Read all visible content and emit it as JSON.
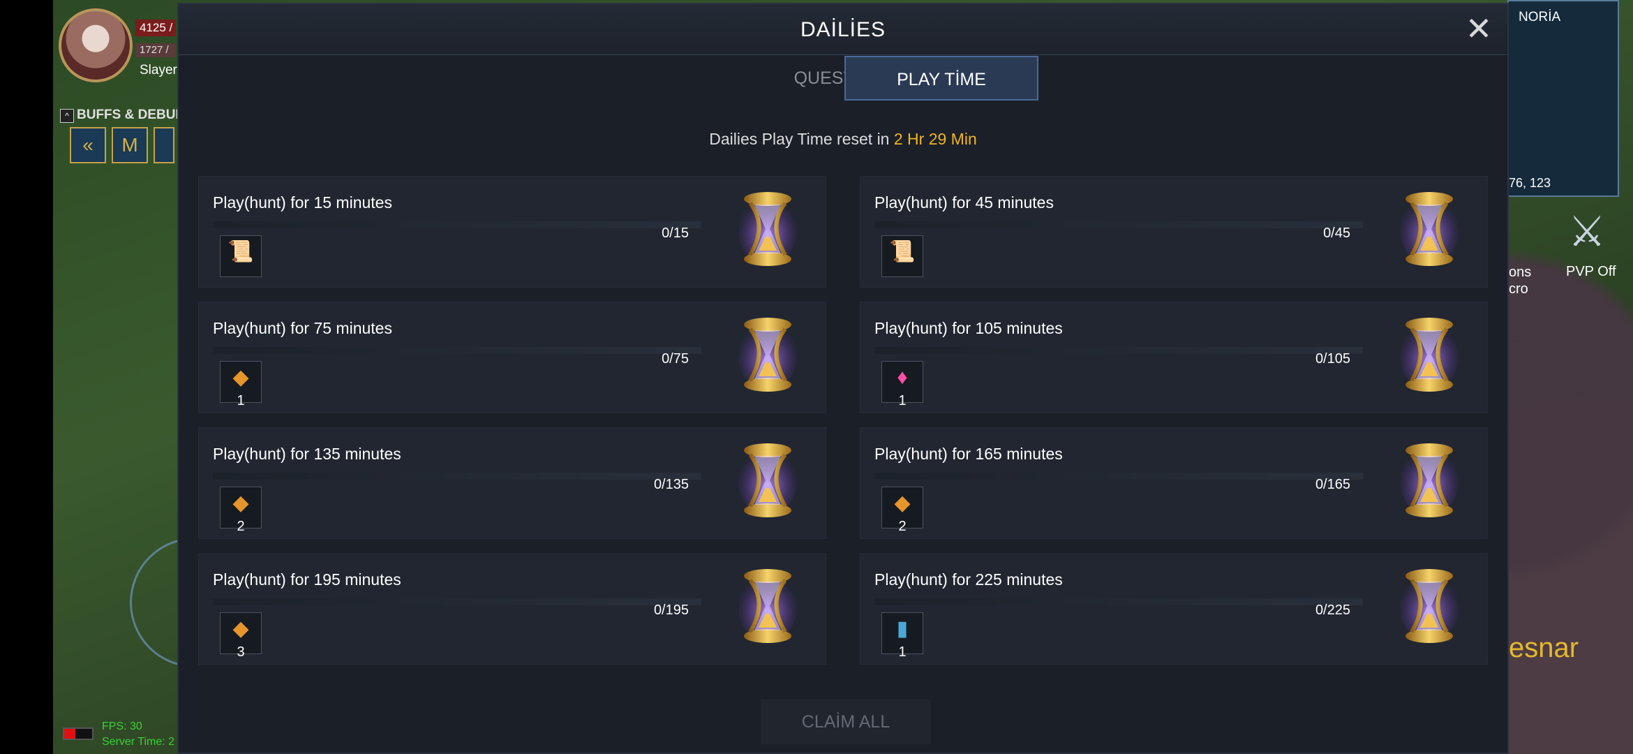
{
  "hud": {
    "hp": "4125 /",
    "mp": "1727 /",
    "class_name": "Slayer",
    "buffs_label": "BUFFS & DEBUFFS",
    "fps": "FPS: 30",
    "server_time": "Server Time: 2",
    "minimap_label": "NORİA",
    "minimap_coords": "76, 123",
    "pvp_label": "PVP Off",
    "cons_label": "ons\ncro",
    "npc_name": "esnar"
  },
  "modal": {
    "title": "DAİLİES",
    "tabs": [
      {
        "label": "QUESTS",
        "active": false
      },
      {
        "label": "PLAY TİME",
        "active": true
      }
    ],
    "reset_prefix": "Dailies Play Time reset in",
    "reset_time": "2 Hr 29 Min",
    "claim_all": "CLAİM ALL",
    "quests": [
      {
        "title": "Play(hunt) for 15 minutes",
        "progress": "0/15",
        "reward_icon": "scroll-icon",
        "qty": ""
      },
      {
        "title": "Play(hunt) for 45 minutes",
        "progress": "0/45",
        "reward_icon": "scroll-icon",
        "qty": ""
      },
      {
        "title": "Play(hunt) for 75 minutes",
        "progress": "0/75",
        "reward_icon": "crystal-icon",
        "qty": "1"
      },
      {
        "title": "Play(hunt) for 105 minutes",
        "progress": "0/105",
        "reward_icon": "gem-icon",
        "qty": "1"
      },
      {
        "title": "Play(hunt) for 135 minutes",
        "progress": "0/135",
        "reward_icon": "crystal-icon",
        "qty": "2"
      },
      {
        "title": "Play(hunt) for 165 minutes",
        "progress": "0/165",
        "reward_icon": "crystal-icon",
        "qty": "2"
      },
      {
        "title": "Play(hunt) for 195 minutes",
        "progress": "0/195",
        "reward_icon": "crystal-icon",
        "qty": "3"
      },
      {
        "title": "Play(hunt) for 225 minutes",
        "progress": "0/225",
        "reward_icon": "card-icon",
        "qty": "1"
      }
    ]
  },
  "colors": {
    "accent": "#f2b51e",
    "panel": "#1a1f28",
    "card": "#212631",
    "tab_active": "#2a3a55"
  }
}
